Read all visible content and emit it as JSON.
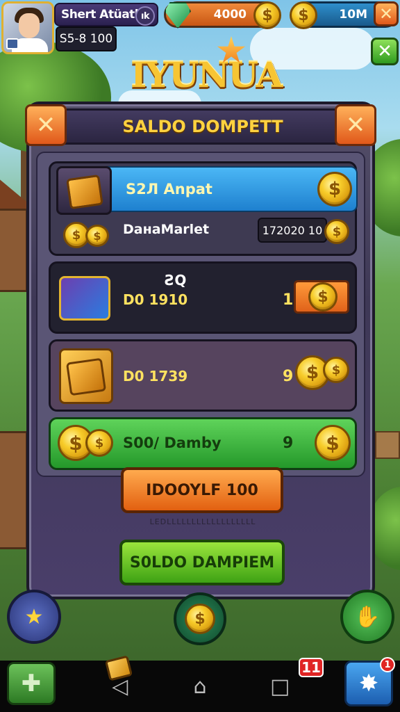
{
  "hud": {
    "player_name": "Shert Atüatlis",
    "player_badge": "ık",
    "level_value": "S5-8 100",
    "gem_amount": "4000",
    "coin_amount": "10M",
    "coin_symbol": "$",
    "close_symbol": "✕"
  },
  "logo": {
    "title": "IYUNUA"
  },
  "dialog": {
    "title": "SALDO DOMPETT",
    "close_symbol": "✕",
    "rows": [
      {
        "title": "S2Л Anpat",
        "label": "DaнaMarlet",
        "value": "172020 10"
      },
      {
        "title": "ƧQ",
        "label": "D0 1910",
        "value": "1"
      },
      {
        "label": "D0 1739",
        "value": "9"
      },
      {
        "label": "S00/ Damby",
        "value": "9"
      }
    ],
    "primary_button": "IDOOYLF 100",
    "primary_sub": "LEDLLLLLLLLLLLLLLLLLL",
    "secondary_button": "S0LDO DAMPIEM"
  },
  "bottom": {
    "star_symbol": "★",
    "coin_symbol": "$",
    "hand_symbol": "✋",
    "plus_symbol": "✚",
    "notification_count": "11",
    "small_badge": "1",
    "nav_back": "◁",
    "nav_home": "⌂",
    "nav_recent": "□"
  },
  "colors": {
    "accent_orange": "#e0581a",
    "accent_green": "#3ea214",
    "title_gold": "#ffd23f",
    "panel_purple": "#3e3856"
  }
}
